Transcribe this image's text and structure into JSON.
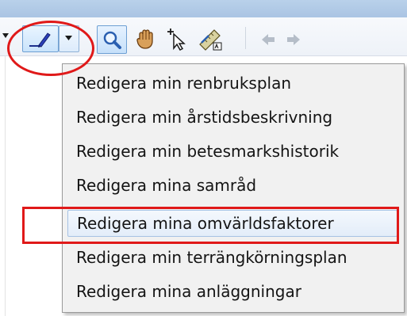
{
  "toolbar": {
    "buttons": [
      {
        "icon": "pen-icon"
      },
      {
        "icon": "chevron-down-icon"
      },
      {
        "icon": "zoom-icon"
      },
      {
        "icon": "pan-hand-icon"
      },
      {
        "icon": "select-arrow-icon"
      },
      {
        "icon": "measure-icon"
      },
      {
        "icon": "back-arrow-icon"
      },
      {
        "icon": "forward-arrow-icon"
      }
    ]
  },
  "menu": {
    "items": [
      {
        "label": "Redigera min renbruksplan"
      },
      {
        "label": "Redigera min årstidsbeskrivning"
      },
      {
        "label": "Redigera min betesmarkshistorik"
      },
      {
        "label": "Redigera mina samråd"
      },
      {
        "label": "Redigera mina omvärldsfaktorer"
      },
      {
        "label": "Redigera min terrängkörningsplan"
      },
      {
        "label": "Redigera mina anläggningar"
      }
    ],
    "highlighted_index": 4
  },
  "annotation_color": "#e01919"
}
